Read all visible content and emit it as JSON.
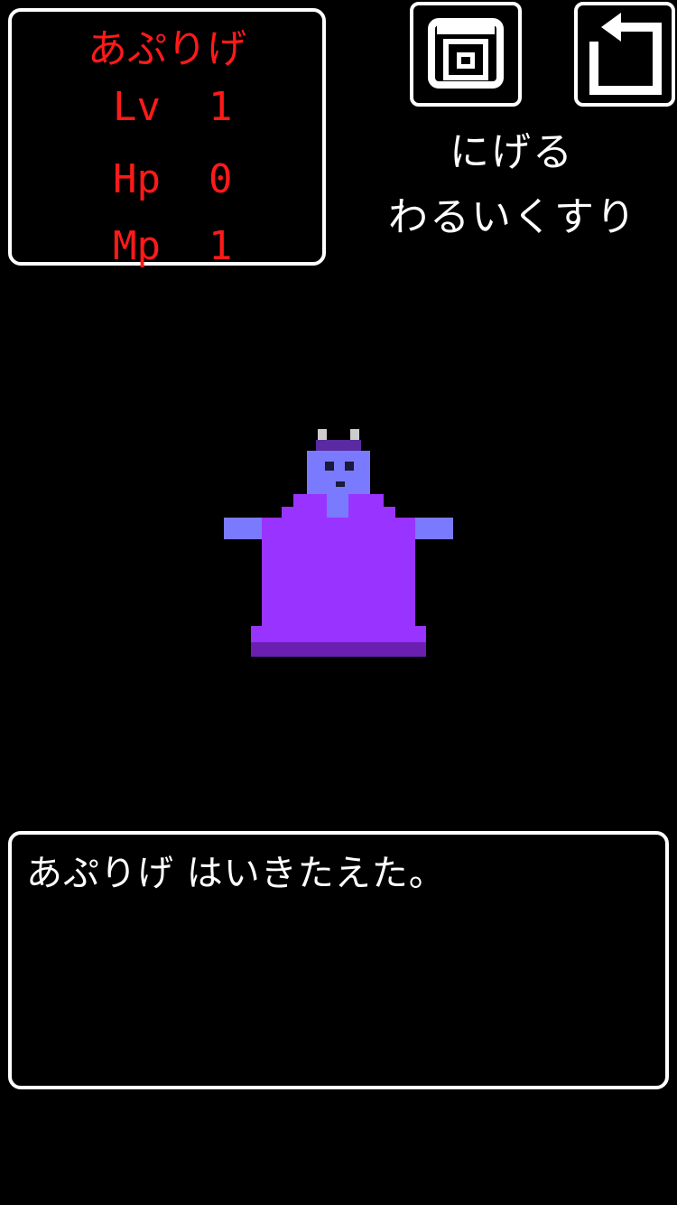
{
  "status": {
    "name": "あぷりげ",
    "lv_label": "Lv",
    "lv_value": "1",
    "hp_label": "Hp",
    "hp_value": "0",
    "mp_label": "Mp",
    "mp_value": "1"
  },
  "toolbar": {
    "camera_icon": "camera-icon",
    "back_icon": "return-arrow-icon"
  },
  "commands": {
    "flee": "にげる",
    "item": "わるいくすり"
  },
  "monster": {
    "sprite": "purple-robed-figure"
  },
  "message": {
    "text": "あぷりげ はいきたえた。"
  },
  "colors": {
    "background": "#000000",
    "frame": "#ffffff",
    "status_text": "#ff1a1a",
    "robe": "#9933ff",
    "robe_shadow": "#6a1fb0",
    "skin": "#7a7aff",
    "hat": "#5a2aa0",
    "horn": "#cccccc"
  }
}
